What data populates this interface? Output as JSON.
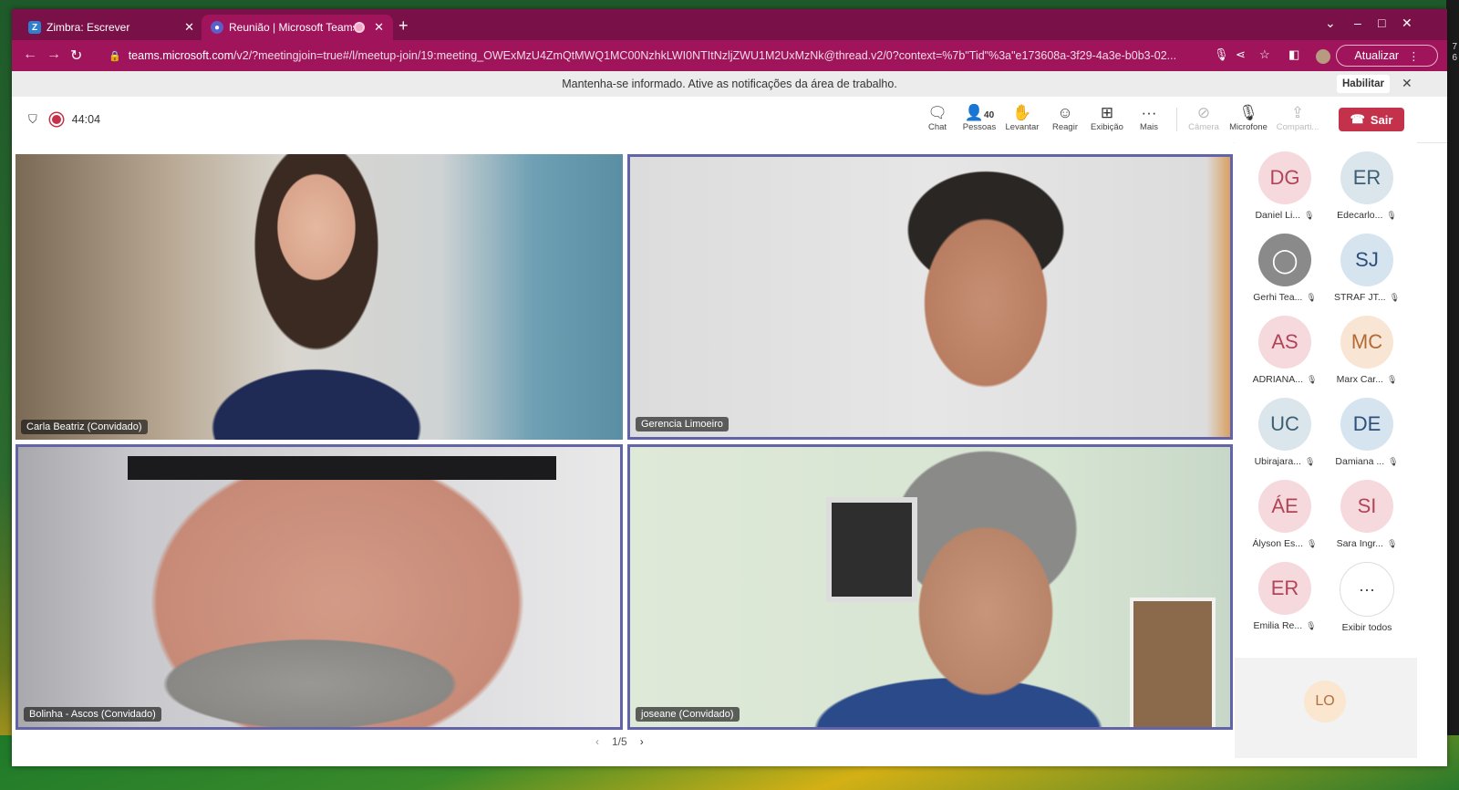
{
  "browser": {
    "tabs": [
      {
        "label": "Zimbra: Escrever",
        "favicon": "Z"
      },
      {
        "label": "Reunião | Microsoft Teams"
      }
    ],
    "url_prefix": "teams.microsoft.com",
    "url_rest": "/v2/?meetingjoin=true#/l/meetup-join/19:meeting_OWExMzU4ZmQtMWQ1MC00NzhkLWI0NTItNzljZWU1M2UxMzNk@thread.v2/0?context=%7b\"Tid\"%3a\"e173608a-3f29-4a3e-b0b3-02...",
    "update_label": "Atualizar"
  },
  "notification": {
    "text": "Mantenha-se informado. Ative as notificações da área de trabalho.",
    "enable_label": "Habilitar"
  },
  "meeting": {
    "timer": "44:04",
    "toolbar": {
      "chat": "Chat",
      "people": "Pessoas",
      "people_count": "40",
      "raise": "Levantar",
      "react": "Reagir",
      "view": "Exibição",
      "more": "Mais",
      "camera": "Câmera",
      "mic": "Microfone",
      "share": "Comparti...",
      "leave": "Sair"
    },
    "tiles": [
      {
        "name": "Carla Beatriz (Convidado)"
      },
      {
        "name": "Gerencia Limoeiro"
      },
      {
        "name": "Bolinha - Ascos (Convidado)"
      },
      {
        "name": "joseane (Convidado)"
      }
    ],
    "pager": "1/5"
  },
  "participants": [
    {
      "initials": "DG",
      "name": "Daniel Li...",
      "style": "pink"
    },
    {
      "initials": "ER",
      "name": "Edecarlo...",
      "style": "teal"
    },
    {
      "initials": "",
      "name": "Gerhi Tea...",
      "style": "gray"
    },
    {
      "initials": "SJ",
      "name": "STRAF JT...",
      "style": "blue"
    },
    {
      "initials": "AS",
      "name": "ADRIANA...",
      "style": "pink"
    },
    {
      "initials": "MC",
      "name": "Marx Car...",
      "style": "peach"
    },
    {
      "initials": "UC",
      "name": "Ubirajara...",
      "style": "teal"
    },
    {
      "initials": "DE",
      "name": "Damiana ...",
      "style": "blue"
    },
    {
      "initials": "ÁE",
      "name": "Ályson Es...",
      "style": "pink"
    },
    {
      "initials": "SI",
      "name": "Sara Ingr...",
      "style": "pink"
    },
    {
      "initials": "ER",
      "name": "Emilia Re...",
      "style": "pink"
    },
    {
      "initials": "···",
      "name": "Exibir todos",
      "style": "more"
    }
  ],
  "featured_participant": {
    "initials": "LO"
  },
  "desktop_edge_text": [
    "7",
    "6"
  ]
}
